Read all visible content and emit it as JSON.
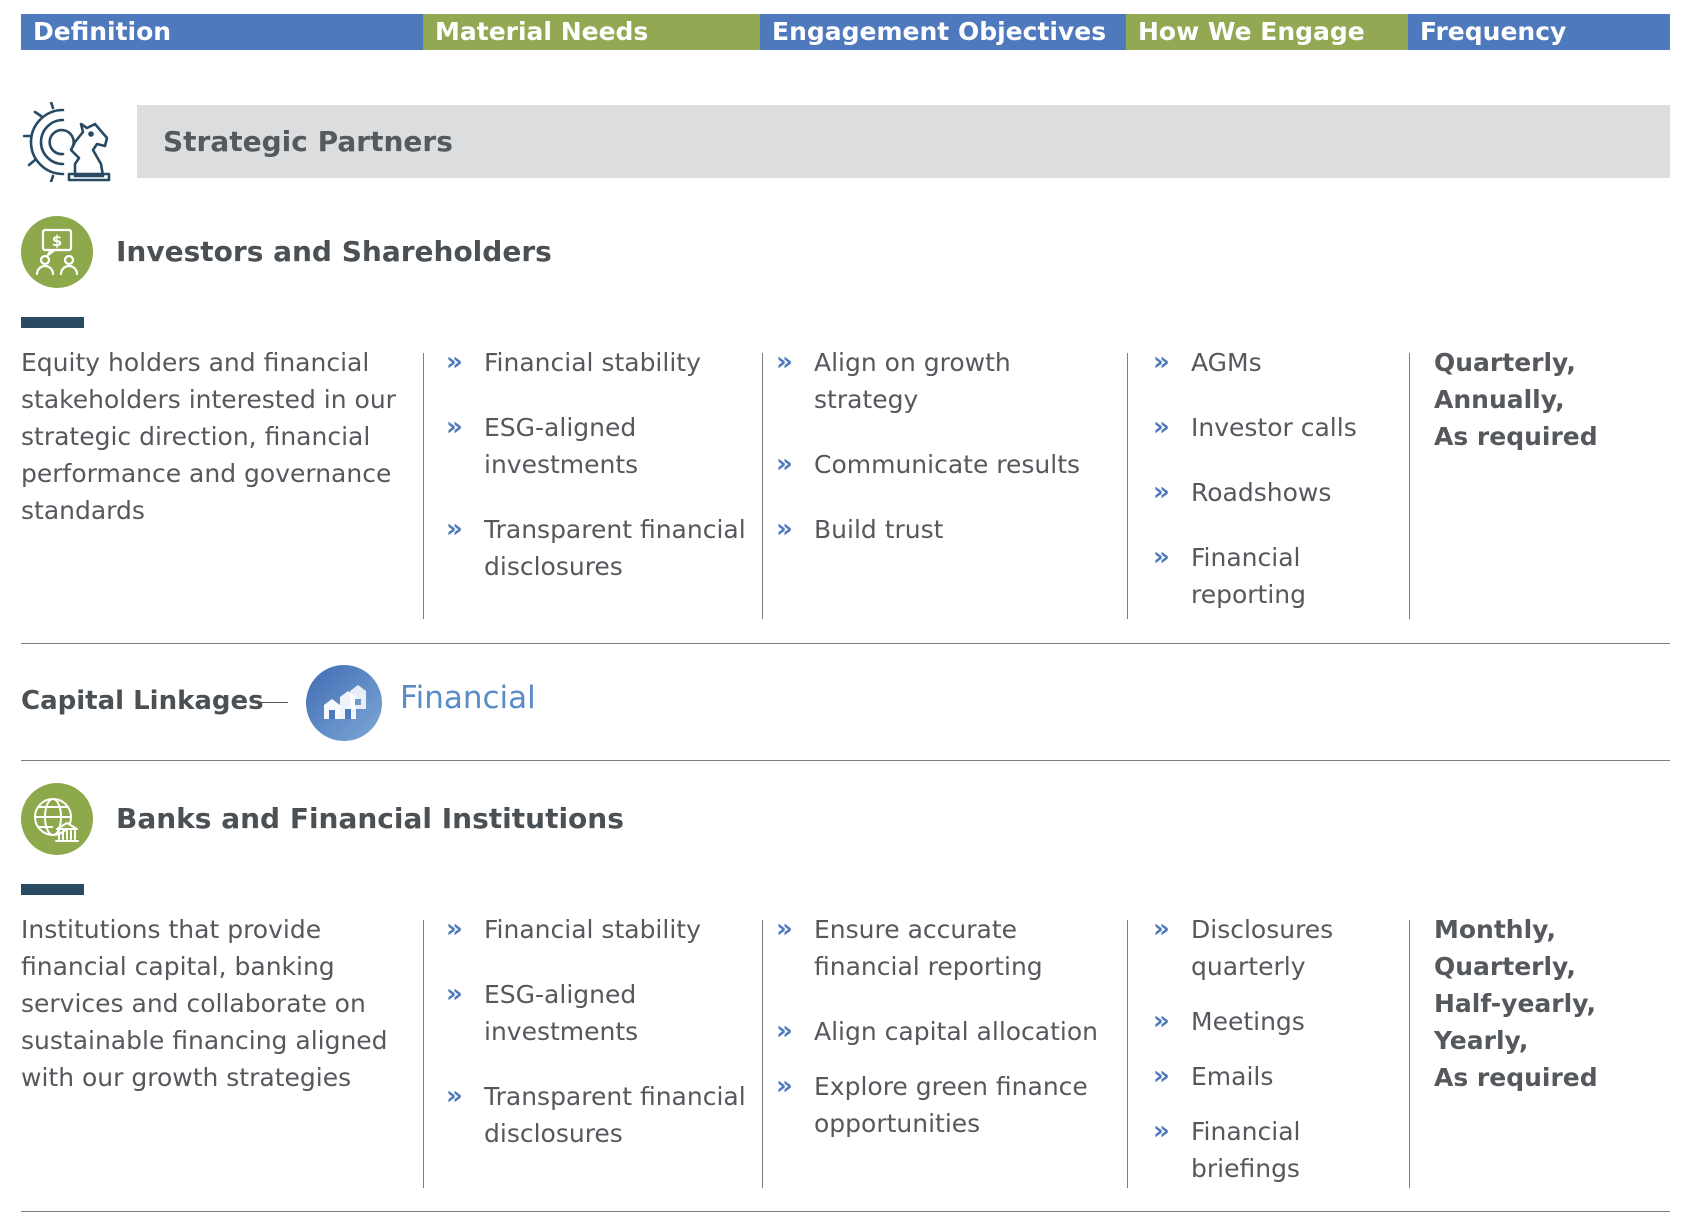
{
  "header": {
    "columns": [
      {
        "label": "Definition",
        "color": "#4f79bd"
      },
      {
        "label": "Material Needs",
        "color": "#93a853"
      },
      {
        "label": "Engagement Objectives",
        "color": "#4f79bd"
      },
      {
        "label": "How We Engage",
        "color": "#93a853"
      },
      {
        "label": "Frequency",
        "color": "#4f79bd"
      }
    ]
  },
  "strategic_partners": {
    "title": "Strategic Partners",
    "icon": "gear-knight-icon"
  },
  "sections": [
    {
      "title": "Investors and Shareholders",
      "icon": "investor-money-icon",
      "definition": "Equity holders and financial stakeholders interested in our strategic direction, financial performance and governance standards",
      "material_needs": [
        "Financial stability",
        "ESG-aligned investments",
        "Transparent financial disclosures"
      ],
      "engagement_objectives": [
        "Align on growth strategy",
        "Communicate results",
        "Build trust"
      ],
      "how_we_engage": [
        "AGMs",
        "Investor calls",
        "Roadshows",
        "Financial reporting"
      ],
      "frequency": [
        "Quarterly,",
        "Annually,",
        "As required"
      ]
    },
    {
      "title": "Banks and Financial Institutions",
      "icon": "globe-bank-icon",
      "definition": "Institutions that provide financial capital, banking services and collaborate on sustainable financing aligned with our growth strategies",
      "material_needs": [
        "Financial stability",
        "ESG-aligned investments",
        "Transparent financial disclosures"
      ],
      "engagement_objectives": [
        "Ensure accurate financial reporting",
        "Align capital allocation",
        "Explore green finance opportunities"
      ],
      "how_we_engage": [
        "Disclosures quarterly",
        "Meetings",
        "Emails",
        "Financial briefings"
      ],
      "frequency": [
        "Monthly,",
        "Quarterly,",
        "Half-yearly,",
        "Yearly,",
        "As required"
      ]
    }
  ],
  "capital_linkages": {
    "label": "Capital Linkages",
    "capital": "Financial",
    "icon": "financial-capital-icon"
  },
  "bullet_glyph": "»"
}
